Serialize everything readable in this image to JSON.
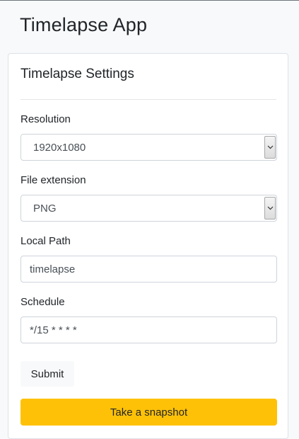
{
  "app": {
    "title": "Timelapse App"
  },
  "card": {
    "title": "Timelapse Settings"
  },
  "form": {
    "resolution": {
      "label": "Resolution",
      "value": "1920x1080"
    },
    "file_extension": {
      "label": "File extension",
      "value": "PNG"
    },
    "local_path": {
      "label": "Local Path",
      "value": "timelapse"
    },
    "schedule": {
      "label": "Schedule",
      "value": "*/15 * * * *"
    },
    "submit_label": "Submit",
    "snapshot_label": "Take a snapshot"
  },
  "icons": {
    "select_arrow": "chevron-down-icon"
  },
  "colors": {
    "snapshot_button": "#ffc107",
    "page_background": "#f8f9fa"
  }
}
